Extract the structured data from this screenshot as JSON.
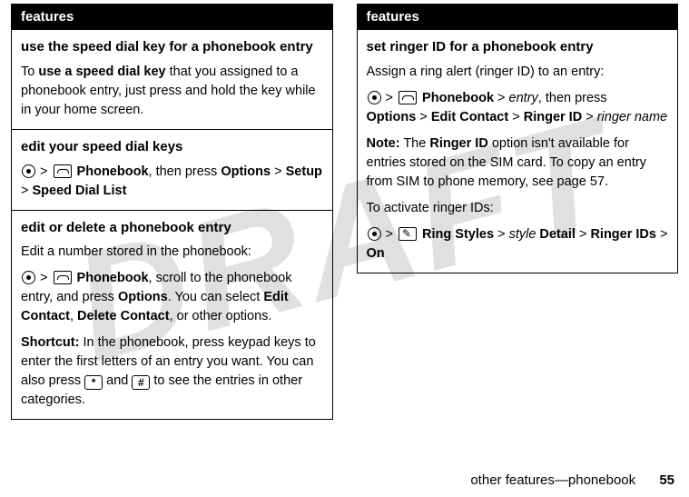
{
  "watermark": "DRAFT",
  "header_label": "features",
  "left": {
    "row1": {
      "title": "use the speed dial key for a phonebook entry",
      "p1_a": "To ",
      "p1_bold": "use a speed dial key",
      "p1_b": " that you assigned to a phonebook entry, just press and hold the key while in your home screen."
    },
    "row2": {
      "title": "edit your speed dial keys",
      "gt1": " > ",
      "phonebook": " Phonebook",
      "mid": ", then press ",
      "options": "Options",
      "gt2": " > ",
      "setup": "Setup",
      "gt3": "> ",
      "sdl": "Speed Dial List"
    },
    "row3": {
      "title": "edit or delete a phonebook entry",
      "p1": "Edit a number stored in the phonebook:",
      "gt1": " > ",
      "phonebook": " Phonebook",
      "p2a": ", scroll to the phonebook entry, and press ",
      "options": "Options",
      "p2b": ". You can select ",
      "editc": "Edit Contact",
      "comma": ", ",
      "delc": "Delete Contact",
      "p2c": ", or other options.",
      "sc_label": "Shortcut:",
      "sc_a": " In the phonebook, press keypad keys to enter the first letters of an entry you want. You can also press ",
      "star": "*",
      "and": " and ",
      "hash": "#",
      "sc_b": " to see the entries in other categories."
    }
  },
  "right": {
    "row1": {
      "title": "set ringer ID for a phonebook entry",
      "p1": "Assign a ring alert (ringer ID) to an entry:",
      "gt1": " > ",
      "phonebook": " Phonebook",
      "gt2": " > ",
      "entry": "entry",
      "then": ", then press ",
      "options": "Options",
      "gt3": " > ",
      "editc": "Edit Contact",
      "gt4": " > ",
      "ringerid": "Ringer ID",
      "gt5": " > ",
      "ringer_name": "ringer name",
      "note_label": "Note:",
      "note_a": " The ",
      "note_rid": "Ringer ID",
      "note_b": " option isn't available for entries stored on the SIM card. To copy an entry from SIM to phone memory, see page 57.",
      "p3": "To activate ringer IDs:",
      "gt6": " > ",
      "ringstyles": " Ring Styles",
      "gt7": " > ",
      "style": "style",
      "detail": " Detail",
      "gt8": " > ",
      "ringerids": "Ringer IDs",
      "gt9": " > ",
      "on": "On"
    }
  },
  "footer": {
    "text": "other features—phonebook",
    "page": "55"
  }
}
